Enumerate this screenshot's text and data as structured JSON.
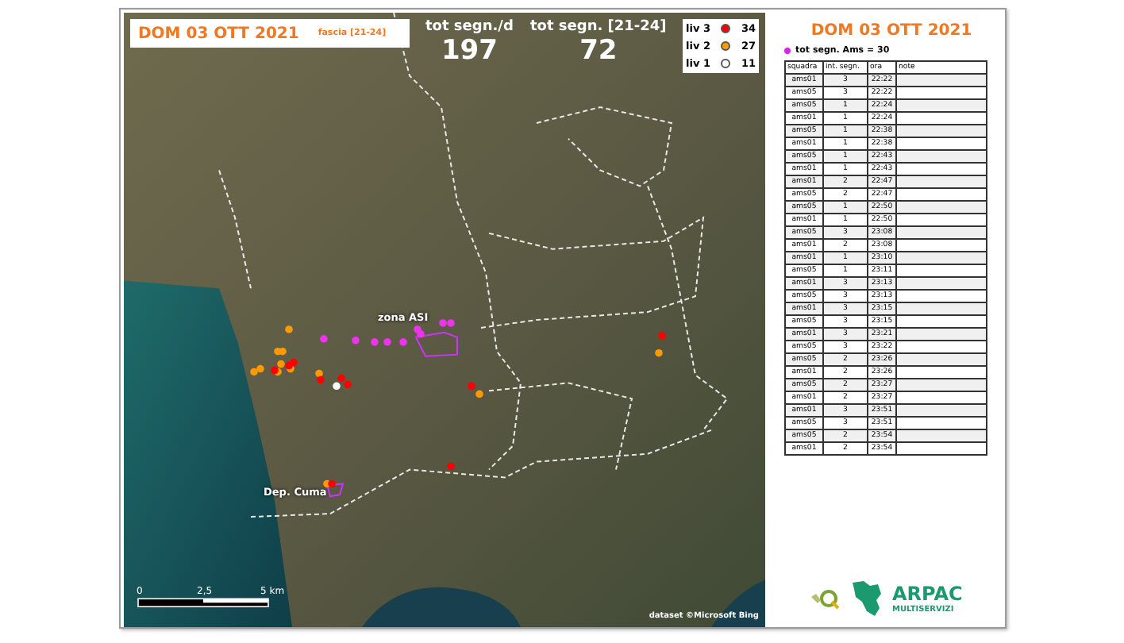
{
  "map": {
    "date_title": "DOM 03 OTT 2021",
    "band": "fascia [21-24]",
    "stats": [
      {
        "label": "tot segn./d",
        "value": "197"
      },
      {
        "label": "tot segn. [21-24]",
        "value": "72"
      }
    ],
    "legend": [
      {
        "label": "liv 3",
        "color": "#ff0000",
        "count": "34"
      },
      {
        "label": "liv 2",
        "color": "#ff9900",
        "count": "27"
      },
      {
        "label": "liv 1",
        "color": "#ffffff",
        "count": "11"
      }
    ],
    "places": [
      "zona ASI",
      "Dep. Cuma"
    ],
    "scale": [
      "0",
      "2,5",
      "5 km"
    ],
    "attribution": "dataset ©Microsoft Bing"
  },
  "panel": {
    "title": "DOM 03 OTT 2021",
    "legend": {
      "label": "tot segn. Ams = 30",
      "color": "#dd22ee"
    },
    "table": {
      "columns": [
        "squadra",
        "int. segn.",
        "ora",
        "note"
      ],
      "rows": [
        [
          "ams01",
          "3",
          "22:22"
        ],
        [
          "ams05",
          "3",
          "22:22"
        ],
        [
          "ams05",
          "1",
          "22:24"
        ],
        [
          "ams01",
          "1",
          "22:24"
        ],
        [
          "ams05",
          "1",
          "22:38"
        ],
        [
          "ams01",
          "1",
          "22:38"
        ],
        [
          "ams05",
          "1",
          "22:43"
        ],
        [
          "ams01",
          "1",
          "22:43"
        ],
        [
          "ams01",
          "2",
          "22:47"
        ],
        [
          "ams05",
          "2",
          "22:47"
        ],
        [
          "ams05",
          "1",
          "22:50"
        ],
        [
          "ams01",
          "1",
          "22:50"
        ],
        [
          "ams05",
          "3",
          "23:08"
        ],
        [
          "ams01",
          "2",
          "23:08"
        ],
        [
          "ams01",
          "1",
          "23:10"
        ],
        [
          "ams05",
          "1",
          "23:11"
        ],
        [
          "ams01",
          "3",
          "23:13"
        ],
        [
          "ams05",
          "3",
          "23:13"
        ],
        [
          "ams01",
          "3",
          "23:15"
        ],
        [
          "ams05",
          "3",
          "23:15"
        ],
        [
          "ams01",
          "3",
          "23:21"
        ],
        [
          "ams05",
          "3",
          "23:22"
        ],
        [
          "ams05",
          "2",
          "23:26"
        ],
        [
          "ams01",
          "2",
          "23:26"
        ],
        [
          "ams05",
          "2",
          "23:27"
        ],
        [
          "ams01",
          "2",
          "23:27"
        ],
        [
          "ams01",
          "3",
          "23:51"
        ],
        [
          "ams05",
          "3",
          "23:51"
        ],
        [
          "ams05",
          "2",
          "23:54"
        ],
        [
          "ams01",
          "2",
          "23:54"
        ]
      ]
    },
    "logo": {
      "name": "ARPAC",
      "subtitle": "MULTISERVIZI"
    }
  }
}
